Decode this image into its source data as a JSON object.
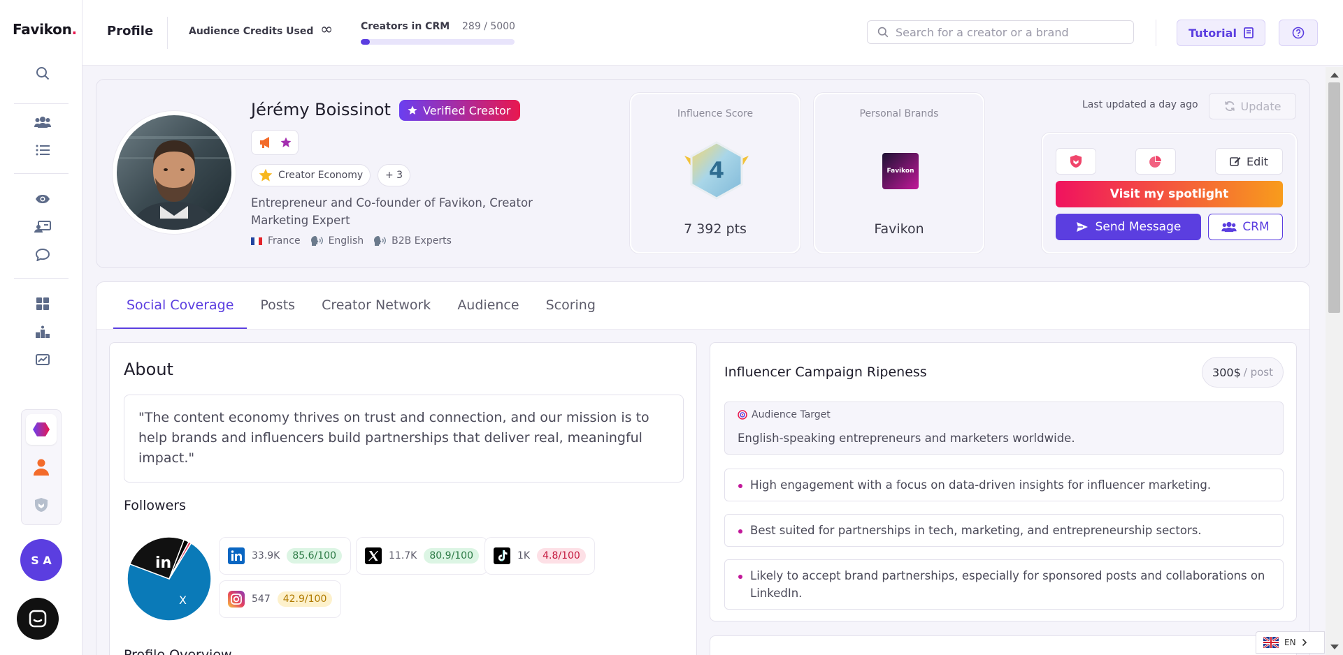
{
  "app": {
    "logo_text": "Favikon",
    "logo_dot": "."
  },
  "topbar": {
    "page_title": "Profile",
    "credits_label": "Audience Credits Used",
    "credits_value": "∞",
    "crm_label": "Creators in CRM",
    "crm_count": "289 / 5000",
    "crm_progress": 0.058,
    "search_placeholder": "Search for a creator or a brand",
    "tutorial_label": "Tutorial"
  },
  "rail": {
    "icons": [
      "search-icon",
      "users-icon",
      "list-icon",
      "eye-icon",
      "id-card-icon",
      "chat-icon",
      "grid-icon",
      "podium-icon",
      "chart-icon"
    ],
    "brand_icons": [
      "hexagon-icon",
      "person-icon",
      "shield-icon"
    ],
    "user_initials": "S A"
  },
  "profile": {
    "name": "Jérémy Boissinot",
    "verified_label": "Verified Creator",
    "niche_label": "Creator Economy",
    "niche_more": "+ 3",
    "description": "Entrepreneur and Co-founder of Favikon, Creator Marketing Expert",
    "country": "France",
    "language": "English",
    "segment": "B2B Experts",
    "influence_label": "Influence Score",
    "influence_rank": "4",
    "influence_points": "7 392 pts",
    "brands_label": "Personal Brands",
    "brand_logo_text": "Favikon",
    "brand_name": "Favikon",
    "last_updated": "Last updated a day ago",
    "update_label": "Update",
    "edit_label": "Edit",
    "spotlight_label": "Visit my spotlight",
    "message_label": "Send Message",
    "crm_label": "CRM"
  },
  "tabs": [
    "Social Coverage",
    "Posts",
    "Creator Network",
    "Audience",
    "Scoring"
  ],
  "about": {
    "title": "About",
    "quote": "\"The content economy thrives on trust and connection, and our mission is to help brands and influencers build partnerships that deliver real, meaningful impact.\"",
    "followers_title": "Followers",
    "next_section_title": "Profile Overview",
    "pie_labels": [
      "in",
      "X"
    ],
    "networks": [
      {
        "name": "LinkedIn",
        "followers": "33.9K",
        "score": "85.6/100",
        "tone": "g",
        "pie_share": 0.72
      },
      {
        "name": "X",
        "followers": "11.7K",
        "score": "80.9/100",
        "tone": "g",
        "pie_share": 0.25
      },
      {
        "name": "TikTok",
        "followers": "1K",
        "score": "4.8/100",
        "tone": "r",
        "pie_share": 0.02
      },
      {
        "name": "Instagram",
        "followers": "547",
        "score": "42.9/100",
        "tone": "y",
        "pie_share": 0.01
      }
    ]
  },
  "ripeness": {
    "title": "Influencer Campaign Ripeness",
    "price": "300$",
    "price_unit": "/ post",
    "target_label": "Audience Target",
    "target_value": "English-speaking entrepreneurs and marketers worldwide.",
    "bullets": [
      "High engagement with a focus on data-driven insights for influencer marketing.",
      "Best suited for partnerships in tech, marketing, and entrepreneurship sectors.",
      "Likely to accept brand partnerships, especially for sponsored posts and collaborations on LinkedIn."
    ]
  },
  "language_switcher": {
    "code": "EN"
  },
  "colors": {
    "accent": "#5b3ee0",
    "brand_red": "#e8184f",
    "linkedin": "#0077b5"
  }
}
